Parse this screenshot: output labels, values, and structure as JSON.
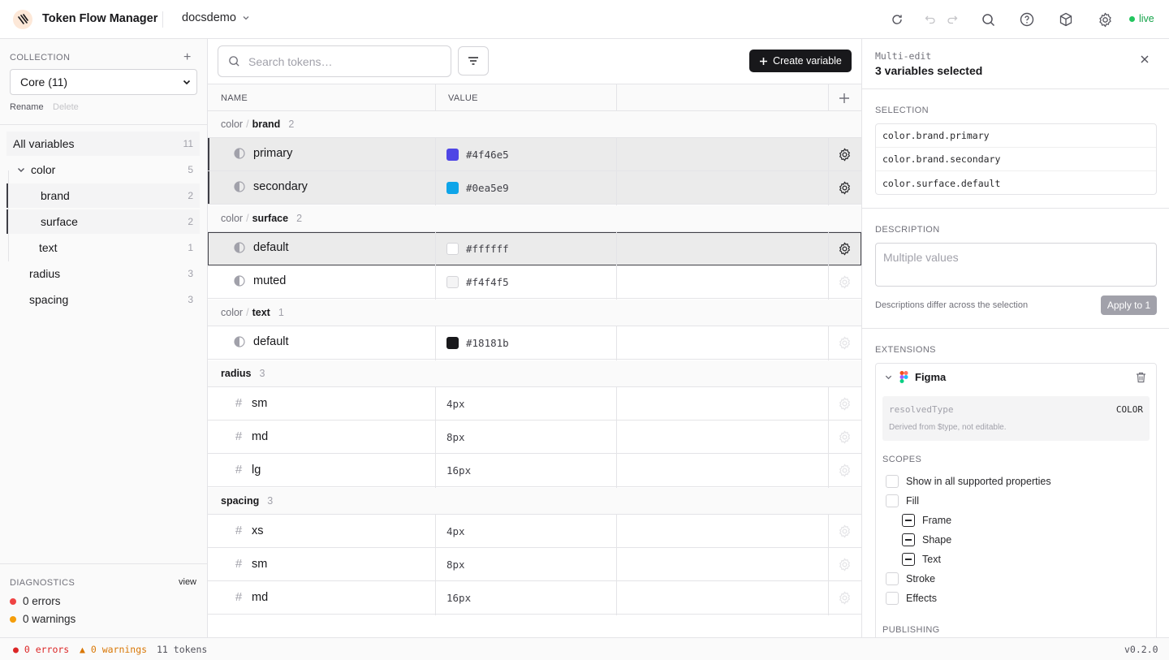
{
  "app": {
    "title": "Token Flow Manager",
    "project": "docsdemo",
    "status": "live"
  },
  "sidebar": {
    "collection_label": "COLLECTION",
    "collection_selected": "Core (11)",
    "rename": "Rename",
    "delete": "Delete",
    "tree": [
      {
        "label": "All variables",
        "count": "11"
      },
      {
        "label": "color",
        "count": "5"
      },
      {
        "label": "brand",
        "count": "2"
      },
      {
        "label": "surface",
        "count": "2"
      },
      {
        "label": "text",
        "count": "1"
      },
      {
        "label": "radius",
        "count": "3"
      },
      {
        "label": "spacing",
        "count": "3"
      }
    ],
    "diagnostics_label": "DIAGNOSTICS",
    "diagnostics_view": "view",
    "errors": "0 errors",
    "warnings": "0 warnings"
  },
  "main": {
    "search_placeholder": "Search tokens…",
    "create_label": "Create variable",
    "col_name": "NAME",
    "col_value": "VALUE",
    "groups": [
      {
        "prefix": "color",
        "name": "brand",
        "count": "2"
      },
      {
        "prefix": "color",
        "name": "surface",
        "count": "2"
      },
      {
        "prefix": "color",
        "name": "text",
        "count": "1"
      },
      {
        "prefix": "",
        "name": "radius",
        "count": "3"
      },
      {
        "prefix": "",
        "name": "spacing",
        "count": "3"
      }
    ],
    "rows": [
      {
        "name": "primary",
        "value": "#4f46e5",
        "swatch": "#4f46e5"
      },
      {
        "name": "secondary",
        "value": "#0ea5e9",
        "swatch": "#0ea5e9"
      },
      {
        "name": "default",
        "value": "#ffffff",
        "swatch": "#ffffff"
      },
      {
        "name": "muted",
        "value": "#f4f4f5",
        "swatch": "#f4f4f5"
      },
      {
        "name": "default",
        "value": "#18181b",
        "swatch": "#18181b"
      },
      {
        "name": "sm",
        "value": "4px"
      },
      {
        "name": "md",
        "value": "8px"
      },
      {
        "name": "lg",
        "value": "16px"
      },
      {
        "name": "xs",
        "value": "4px"
      },
      {
        "name": "sm",
        "value": "8px"
      },
      {
        "name": "md",
        "value": "16px"
      }
    ]
  },
  "panel": {
    "subtitle": "Multi-edit",
    "title": "3 variables selected",
    "selection_label": "SELECTION",
    "selection": [
      "color.brand.primary",
      "color.brand.secondary",
      "color.surface.default"
    ],
    "description_label": "DESCRIPTION",
    "description_placeholder": "Multiple values",
    "description_note": "Descriptions differ across the selection",
    "apply_label": "Apply to 1",
    "extensions_label": "EXTENSIONS",
    "ext_name": "Figma",
    "resolved_key": "resolvedType",
    "resolved_value": "COLOR",
    "resolved_note": "Derived from $type, not editable.",
    "scopes_label": "SCOPES",
    "scopes": [
      "Show in all supported properties",
      "Fill",
      "Frame",
      "Shape",
      "Text",
      "Stroke",
      "Effects"
    ],
    "publishing_label": "PUBLISHING"
  },
  "statusbar": {
    "errors": "● 0 errors",
    "warnings": "▲ 0 warnings",
    "tokens": "11 tokens",
    "version": "v0.2.0"
  },
  "colors": {
    "accent": "#18181b",
    "live": "#22c55e",
    "error": "#dc2626",
    "warning": "#f59e0b"
  }
}
